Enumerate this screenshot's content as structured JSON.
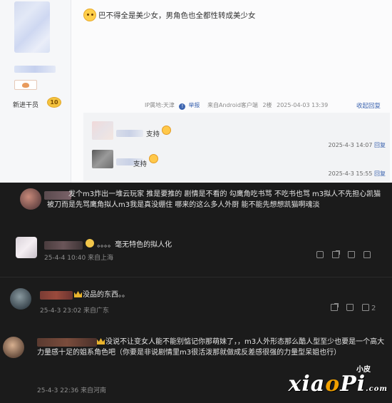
{
  "post": {
    "text": "巴不得全是美少女，男角色也全都性转成美少女",
    "level_label": "新进干员",
    "level_number": "10",
    "meta": {
      "ip": "IP属地:天津",
      "report": "举报",
      "client": "来自Android客户端",
      "floor": "2楼",
      "datetime": "2025-04-03 13:39",
      "reply_toggle": "收起回复"
    },
    "replies": [
      {
        "text": "支持",
        "time": "2025-4-3 14:07",
        "reply_label": "回复"
      },
      {
        "text": "支持",
        "time": "2025-4-3 15:55",
        "reply_label": "回复"
      }
    ]
  },
  "comments": [
    {
      "text": "发个m3炸出一堆云玩家 推是要推的 剧情是不看的 勾鹰角吃书骂 不吃书也骂 m3拟人不先担心凯猫被刀而是先骂鹰角拟人m3我是真没绷住 哪来的这么多人外厨 能不能先想想凯猫啊魂淡",
      "meta": "",
      "likes": ""
    },
    {
      "text": "。。。。毫无特色的拟人化",
      "meta": "25-4-4 10:40 来自上海",
      "likes": ""
    },
    {
      "text": "没品的东西。。",
      "meta": "25-4-3 23:02 来自广东",
      "likes": "2"
    },
    {
      "text": "没说不让变女人能不能别惦记你那萌妹了，，m3人外形态那么酷人型至少也要是一个高大力量感十足的姐系角色吧（你要是非说剧情里m3很活泼那就做成反差感很强的力量型呆姐也行）",
      "meta": "25-4-3 22:36 来自河南",
      "likes": ""
    }
  ],
  "watermark": {
    "top": "小皮",
    "main_a": "xia",
    "main_o": "o",
    "main_b": "Pi",
    "main_tld": ".com"
  },
  "colors": {
    "link": "#3d65b0",
    "dark_bg": "#1b1b1b",
    "badge": "#f4c33e",
    "crown": "#e9b32d"
  }
}
